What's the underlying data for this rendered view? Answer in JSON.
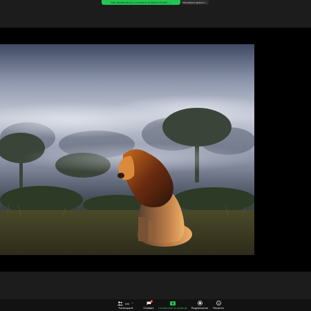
{
  "app": {
    "share_banner_text": "Stai visualizzando lo schermo di Marco Gentili",
    "view_options_label": "Visualizza opzioni",
    "shared_image_alt": "Leone seduto nella savana nebbiosa all'alba"
  },
  "toolbar": {
    "participants": {
      "label": "Partecipanti",
      "count": "104",
      "icon": "participants-icon"
    },
    "chat": {
      "label": "Chattare",
      "badge": "2",
      "icon": "chat-icon"
    },
    "share": {
      "label": "Condividere lo schermo",
      "icon": "share-screen-icon"
    },
    "record": {
      "label": "Registrazione",
      "icon": "record-icon"
    },
    "reactions": {
      "label": "Reazioni",
      "icon": "reactions-icon"
    }
  },
  "colors": {
    "banner_green": "#23c552",
    "share_green": "#27c24c",
    "badge_red": "#e02828",
    "toolbar_bg": "#121212"
  }
}
